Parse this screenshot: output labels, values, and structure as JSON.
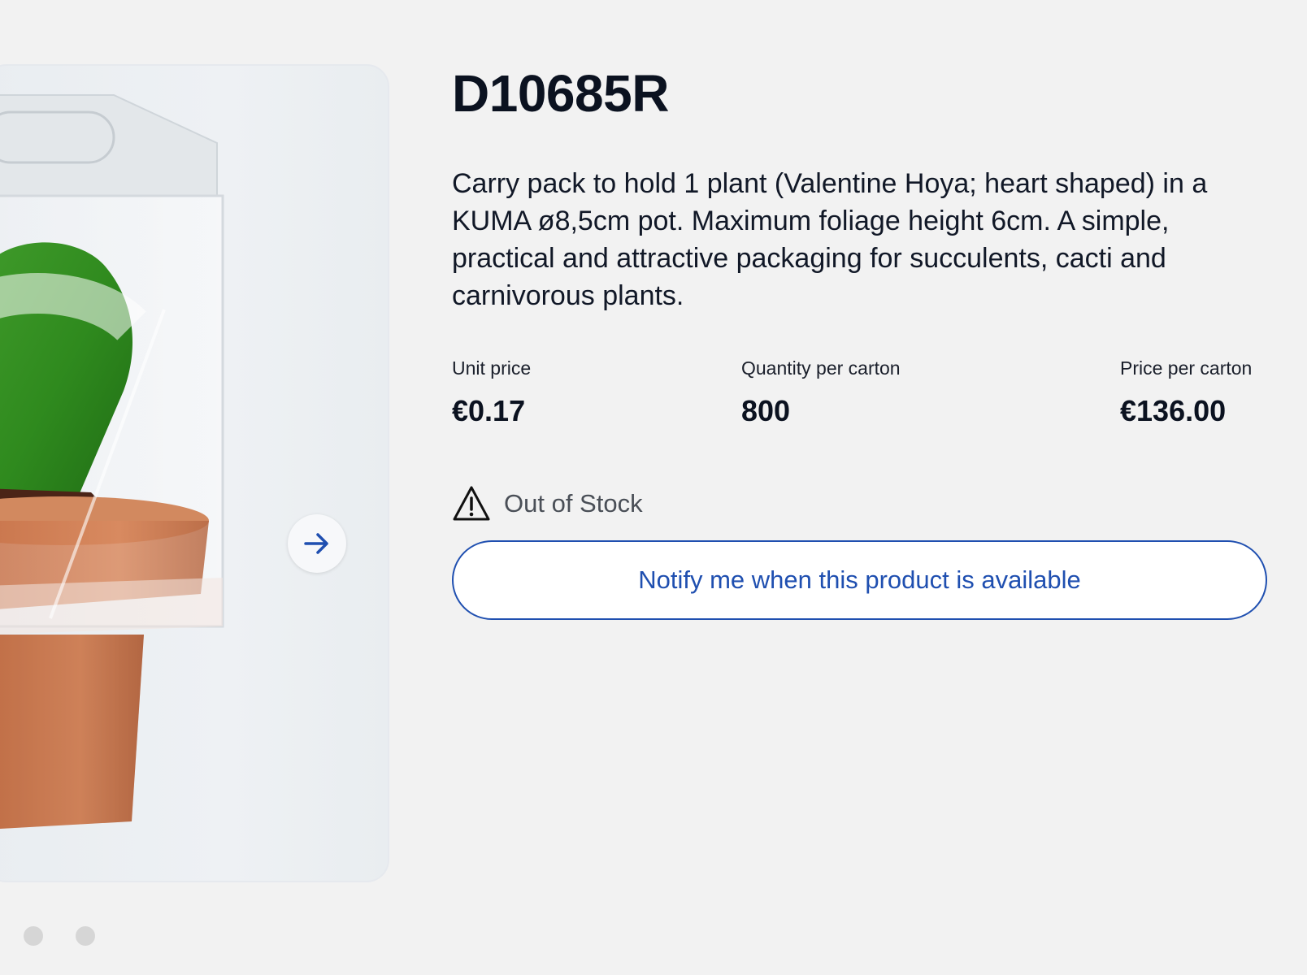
{
  "product": {
    "code": "D10685R",
    "description": "Carry pack to hold 1 plant (Valentine Hoya; heart shaped) in a KUMA ø8,5cm pot. Maximum foliage height 6cm. A simple, practical and attractive packaging for succulents, cacti and carnivorous plants."
  },
  "pricing": {
    "unit_price_label": "Unit price",
    "unit_price_value": "€0.17",
    "quantity_label": "Quantity per carton",
    "quantity_value": "800",
    "carton_price_label": "Price per carton",
    "carton_price_value": "€136.00"
  },
  "stock": {
    "status_text": "Out of Stock",
    "icon": "warning-triangle-icon"
  },
  "actions": {
    "notify_label": "Notify me when this product is available"
  },
  "gallery": {
    "next_icon": "arrow-right-icon",
    "dot_count": 2
  },
  "colors": {
    "accent": "#1f4fb0",
    "background": "#f2f2f2",
    "title": "#0b1220"
  }
}
